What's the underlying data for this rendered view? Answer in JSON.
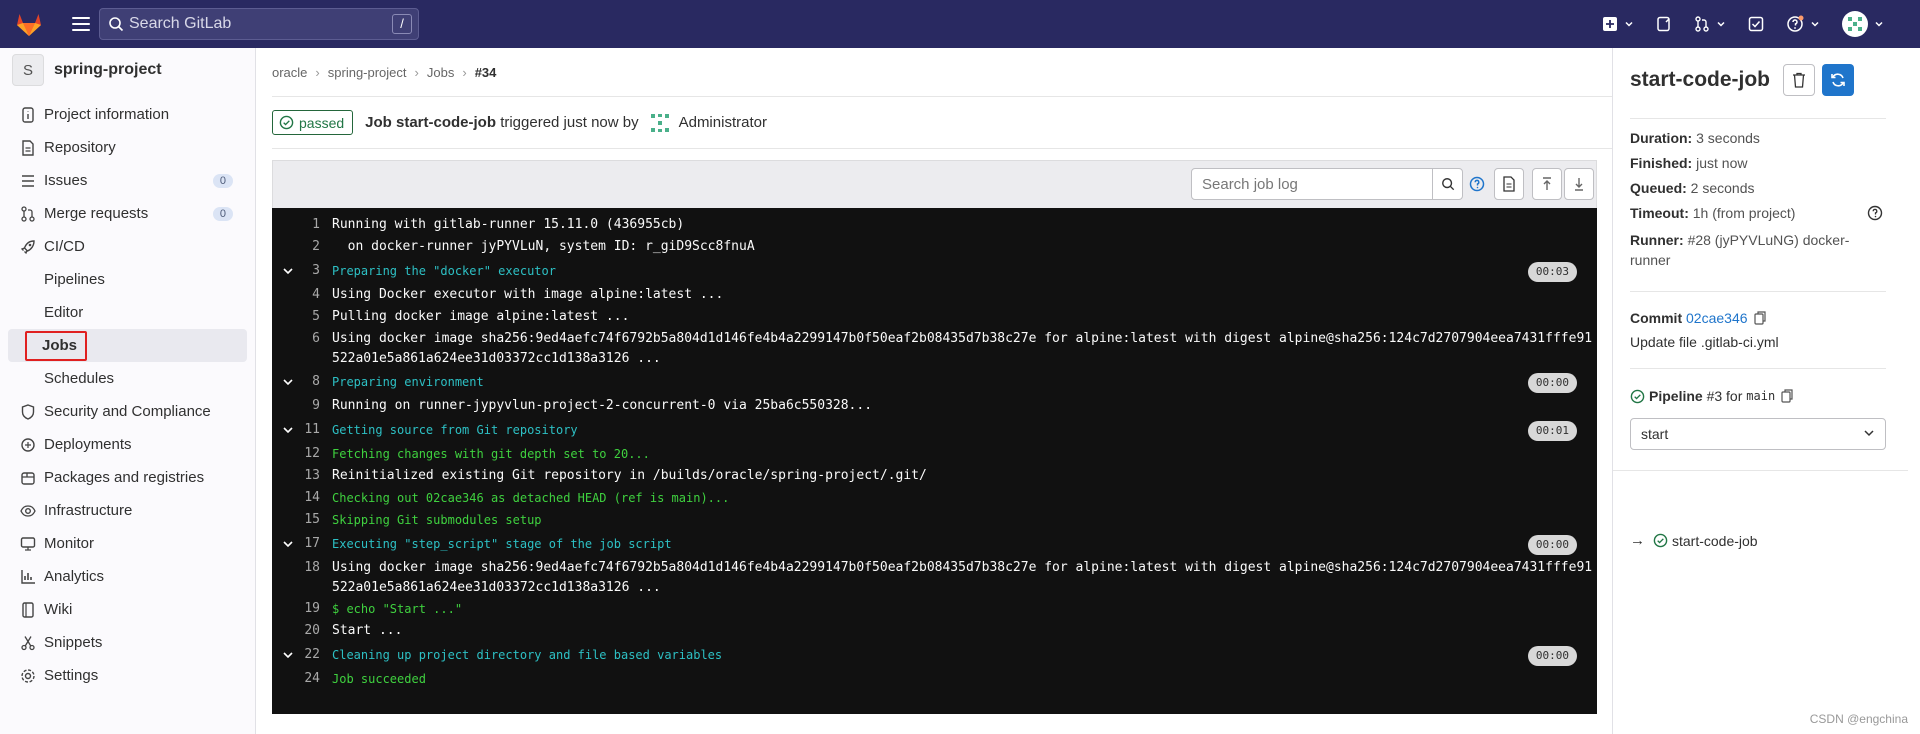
{
  "topbar": {
    "search_placeholder": "Search GitLab",
    "search_shortcut": "/"
  },
  "sidebar": {
    "project_initial": "S",
    "project_name": "spring-project",
    "items": [
      {
        "label": "Project information",
        "icon": "info-icon"
      },
      {
        "label": "Repository",
        "icon": "doc-icon"
      },
      {
        "label": "Issues",
        "icon": "issues-icon",
        "badge": "0"
      },
      {
        "label": "Merge requests",
        "icon": "merge-icon",
        "badge": "0"
      },
      {
        "label": "CI/CD",
        "icon": "rocket-icon"
      }
    ],
    "cicd_sub": [
      "Pipelines",
      "Editor",
      "Jobs",
      "Schedules"
    ],
    "items2": [
      {
        "label": "Security and Compliance",
        "icon": "shield-icon"
      },
      {
        "label": "Deployments",
        "icon": "deploy-icon"
      },
      {
        "label": "Packages and registries",
        "icon": "package-icon"
      },
      {
        "label": "Infrastructure",
        "icon": "cloud-icon"
      },
      {
        "label": "Monitor",
        "icon": "monitor-icon"
      },
      {
        "label": "Analytics",
        "icon": "chart-icon"
      },
      {
        "label": "Wiki",
        "icon": "book-icon"
      },
      {
        "label": "Snippets",
        "icon": "scissors-icon"
      },
      {
        "label": "Settings",
        "icon": "gear-icon"
      }
    ]
  },
  "breadcrumb": [
    "oracle",
    "spring-project",
    "Jobs",
    "#34"
  ],
  "job": {
    "status": "passed",
    "prefix": "Job",
    "name": "start-code-job",
    "triggered": "triggered just now by",
    "user": "Administrator"
  },
  "log_toolbar": {
    "search_placeholder": "Search job log"
  },
  "log": [
    {
      "n": "1",
      "t": "Running with gitlab-runner 15.11.0 (436955cb)",
      "c": "white"
    },
    {
      "n": "2",
      "t": "  on docker-runner jyPYVLuN, system ID: r_giD9Scc8fnuA",
      "c": "white"
    },
    {
      "n": "3",
      "t": "Preparing the \"docker\" executor",
      "c": "cyan",
      "section": true,
      "dur": "00:03"
    },
    {
      "n": "4",
      "t": "Using Docker executor with image alpine:latest ...",
      "c": "white"
    },
    {
      "n": "5",
      "t": "Pulling docker image alpine:latest ...",
      "c": "white"
    },
    {
      "n": "6",
      "t": "Using docker image sha256:9ed4aefc74f6792b5a804d1d146fe4b4a2299147b0f50eaf2b08435d7b38c27e for alpine:latest with digest alpine@sha256:124c7d2707904eea7431fffe91522a01e5a861a624ee31d03372cc1d138a3126 ...",
      "c": "white",
      "wrap": true
    },
    {
      "n": "8",
      "t": "Preparing environment",
      "c": "cyan",
      "section": true,
      "dur": "00:00"
    },
    {
      "n": "9",
      "t": "Running on runner-jypyvlun-project-2-concurrent-0 via 25ba6c550328...",
      "c": "white"
    },
    {
      "n": "11",
      "t": "Getting source from Git repository",
      "c": "cyan",
      "section": true,
      "dur": "00:01"
    },
    {
      "n": "12",
      "t": "Fetching changes with git depth set to 20...",
      "c": "green"
    },
    {
      "n": "13",
      "t": "Reinitialized existing Git repository in /builds/oracle/spring-project/.git/",
      "c": "white"
    },
    {
      "n": "14",
      "t": "Checking out 02cae346 as detached HEAD (ref is main)...",
      "c": "green"
    },
    {
      "n": "15",
      "t": "Skipping Git submodules setup",
      "c": "green"
    },
    {
      "n": "17",
      "t": "Executing \"step_script\" stage of the job script",
      "c": "cyan",
      "section": true,
      "dur": "00:00"
    },
    {
      "n": "18",
      "t": "Using docker image sha256:9ed4aefc74f6792b5a804d1d146fe4b4a2299147b0f50eaf2b08435d7b38c27e for alpine:latest with digest alpine@sha256:124c7d2707904eea7431fffe91522a01e5a861a624ee31d03372cc1d138a3126 ...",
      "c": "white",
      "wrap": true
    },
    {
      "n": "19",
      "t": "$ echo \"Start ...\"",
      "c": "green"
    },
    {
      "n": "20",
      "t": "Start ...",
      "c": "white"
    },
    {
      "n": "22",
      "t": "Cleaning up project directory and file based variables",
      "c": "cyan",
      "section": true,
      "dur": "00:00"
    },
    {
      "n": "24",
      "t": "Job succeeded",
      "c": "green"
    }
  ],
  "right_panel": {
    "title": "start-code-job",
    "duration_label": "Duration:",
    "duration": "3 seconds",
    "finished_label": "Finished:",
    "finished": "just now",
    "queued_label": "Queued:",
    "queued": "2 seconds",
    "timeout_label": "Timeout:",
    "timeout": "1h (from project)",
    "runner_label": "Runner:",
    "runner": "#28 (jyPYVLuNG) docker-runner",
    "commit_label": "Commit",
    "commit_sha": "02cae346",
    "commit_msg": "Update file .gitlab-ci.yml",
    "pipeline_label": "Pipeline",
    "pipeline_num": "#3",
    "pipeline_for": "for",
    "pipeline_ref": "main",
    "stage_select": "start",
    "job_link": "start-code-job"
  },
  "watermark": "CSDN @engchina",
  "colors": {
    "topbar": "#292961",
    "passed": "#217645",
    "link": "#1f75cb",
    "log_bg": "#111111",
    "log_cyan": "#2dc0c4",
    "log_green": "#3fd13f"
  }
}
